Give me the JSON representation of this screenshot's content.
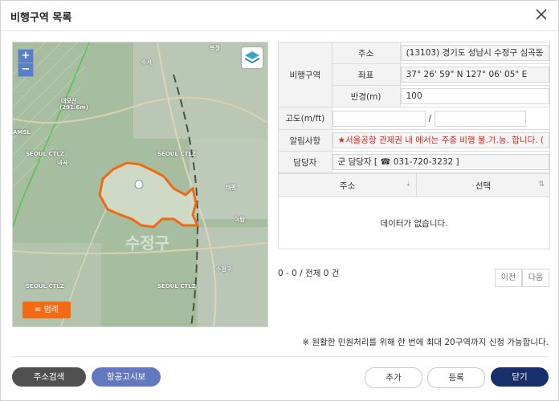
{
  "dialog": {
    "title": "비행구역 목록"
  },
  "map": {
    "zoom_in": "+",
    "zoom_out": "−",
    "legend_label": "범례",
    "legend_icon": "≡",
    "labels": [
      "대모산",
      "(291.6m)",
      "AMSL",
      "SEOUL CTLZ",
      "SEOUL CTLZ",
      "SEOUL CTLZ",
      "SEOUL CTLZ",
      "수서",
      "복정",
      "내곡",
      "태평",
      "수정구",
      "야탑"
    ],
    "big_label": "수정구"
  },
  "info": {
    "zone_label": "비행구역",
    "address_label": "주소",
    "address_value": "(13103) 경기도 성남시 수정구 심곡동",
    "coord_label": "좌표",
    "coord_value": "37° 26' 59\" N 127° 06' 05\" E",
    "radius_label": "반경(m)",
    "radius_value": "100",
    "altitude_label": "고도(m/ft)",
    "altitude_sep": "/",
    "notice_label": "알림사항",
    "notice_value": "★서울공항 관제권 내 에서는 주중 비행  불.가.능. 합니다. (",
    "manager_label": "담당자",
    "manager_value": "군 담당자 [ ☎ 031-720-3232 ]"
  },
  "list": {
    "col_address": "주소",
    "col_select": "선택",
    "sort_icon_1": "⇣",
    "sort_icon_2": "⇅",
    "empty": "데이터가 없습니다."
  },
  "pager": {
    "info": "0 - 0 / 전체 0 건",
    "prev": "이전",
    "next": "다음"
  },
  "notice": "※ 원활한 민원처리를 위해 한 번에 최대 20구역까지 신청 가능합니다.",
  "buttons": {
    "address_search": "주소검색",
    "aviation_notice": "항공고시보",
    "add": "추가",
    "register": "등록",
    "close": "닫기"
  },
  "colors": {
    "accent_orange": "#f26b13",
    "navy": "#17306b",
    "blue": "#6478bf",
    "alert_red": "#d9271c"
  }
}
